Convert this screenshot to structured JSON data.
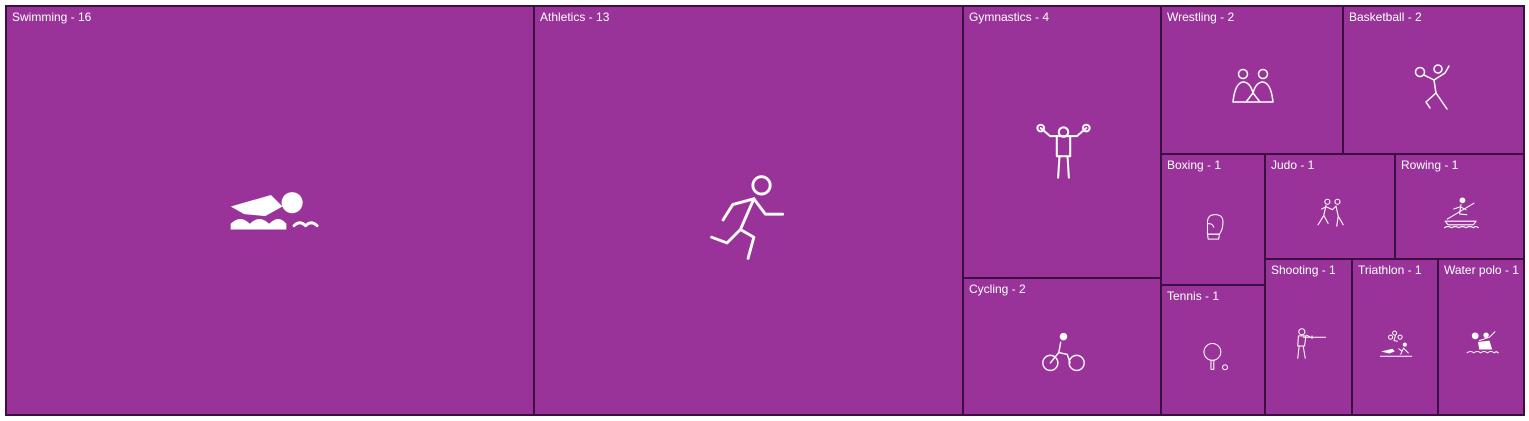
{
  "chart_data": {
    "type": "treemap",
    "colors": {
      "tile": "#993399",
      "border": "#3b1040",
      "text": "#ffffff"
    },
    "items": [
      {
        "name": "Swimming",
        "value": 16,
        "label": "Swimming - 16",
        "icon": "swimming-icon"
      },
      {
        "name": "Athletics",
        "value": 13,
        "label": "Athletics - 13",
        "icon": "athletics-icon"
      },
      {
        "name": "Gymnastics",
        "value": 4,
        "label": "Gymnastics - 4",
        "icon": "gymnastics-icon"
      },
      {
        "name": "Cycling",
        "value": 2,
        "label": "Cycling - 2",
        "icon": "cycling-icon"
      },
      {
        "name": "Wrestling",
        "value": 2,
        "label": "Wrestling - 2",
        "icon": "wrestling-icon"
      },
      {
        "name": "Basketball",
        "value": 2,
        "label": "Basketball - 2",
        "icon": "basketball-icon"
      },
      {
        "name": "Boxing",
        "value": 1,
        "label": "Boxing - 1",
        "icon": "boxing-icon"
      },
      {
        "name": "Tennis",
        "value": 1,
        "label": "Tennis - 1",
        "icon": "table-tennis-icon"
      },
      {
        "name": "Judo",
        "value": 1,
        "label": "Judo - 1",
        "icon": "judo-icon"
      },
      {
        "name": "Rowing",
        "value": 1,
        "label": "Rowing - 1",
        "icon": "rowing-icon"
      },
      {
        "name": "Shooting",
        "value": 1,
        "label": "Shooting - 1",
        "icon": "shooting-icon"
      },
      {
        "name": "Triathlon",
        "value": 1,
        "label": "Triathlon - 1",
        "icon": "triathlon-icon"
      },
      {
        "name": "Water polo",
        "value": 1,
        "label": "Water polo - 1",
        "icon": "water-polo-icon"
      }
    ]
  }
}
